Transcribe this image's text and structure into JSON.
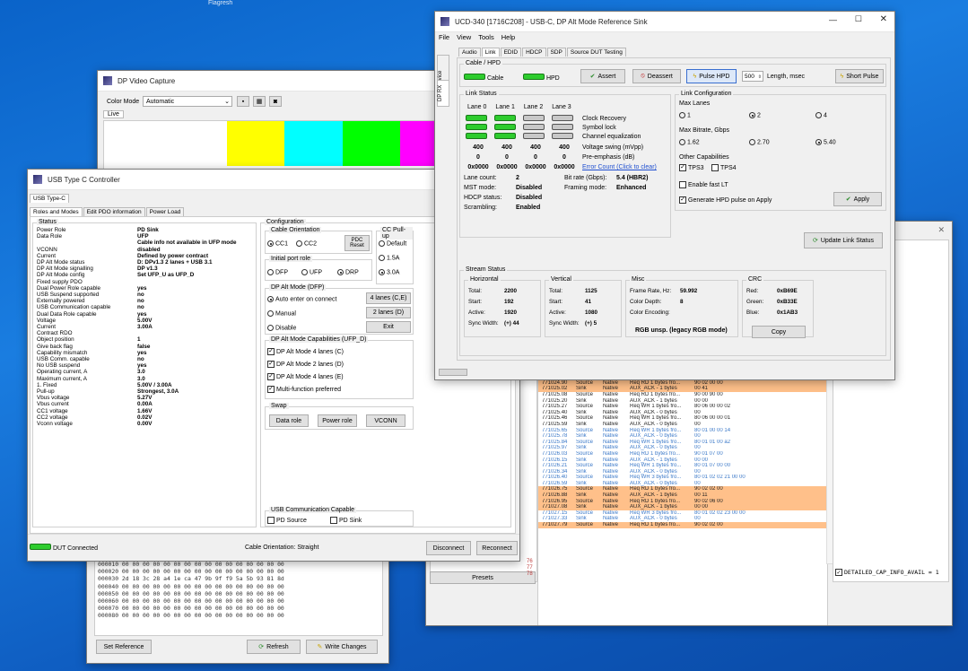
{
  "desktop": {
    "top_label": "Flagresh"
  },
  "capture": {
    "title": "DP Video Capture",
    "color_mode_label": "Color Mode",
    "color_mode_value": "Automatic",
    "tab": "Live",
    "bars": [
      "#ffffff",
      "#ffff00",
      "#00ffff",
      "#00ff00",
      "#ff00ff",
      "#ff0000",
      "#0000ff"
    ]
  },
  "ucd": {
    "title": "UCD-340 [1716C208] - USB-C, DP Alt Mode Reference Sink",
    "menu": [
      "File",
      "View",
      "Tools",
      "Help"
    ],
    "side_tabs": [
      "Device",
      "DP RX"
    ],
    "tabs": [
      "Audio",
      "Link",
      "EDID",
      "HDCP",
      "SDP",
      "Source DUT Testing"
    ],
    "cable_hpd": {
      "group": "Cable / HPD",
      "cable": "Cable",
      "hpd": "HPD",
      "assert": "Assert",
      "deassert": "Deassert",
      "pulse": "Pulse HPD",
      "pulse_len": "500",
      "len_label": "Length, msec",
      "short_pulse": "Short Pulse"
    },
    "link_status": {
      "group": "Link Status",
      "lanes": [
        "Lane 0",
        "Lane 1",
        "Lane 2",
        "Lane 3"
      ],
      "rows": [
        "Clock Recovery",
        "Symbol lock",
        "Channel equalization"
      ],
      "swing": [
        "400",
        "400",
        "400",
        "400"
      ],
      "swing_label": "Voltage swing (mVpp)",
      "pre": [
        "0",
        "0",
        "0",
        "0"
      ],
      "pre_label": "Pre-emphasis (dB)",
      "err": [
        "0x0000",
        "0x0000",
        "0x0000",
        "0x0000"
      ],
      "err_label": "Error Count (Click to clear)",
      "lane_count_l": "Lane count:",
      "lane_count": "2",
      "bitrate_l": "Bit rate (Gbps):",
      "bitrate": "5.4 (HBR2)",
      "mst_l": "MST mode:",
      "mst": "Disabled",
      "framing_l": "Framing mode:",
      "framing": "Enhanced",
      "hdcp_l": "HDCP status:",
      "hdcp": "Disabled",
      "scr_l": "Scrambling:",
      "scr": "Enabled"
    },
    "link_config": {
      "group": "Link Configuration",
      "max_lanes": "Max Lanes",
      "lanes": [
        "1",
        "2",
        "4"
      ],
      "bitrate_label": "Max Bitrate, Gbps",
      "rates": [
        "1.62",
        "2.70",
        "5.40"
      ],
      "other": "Other Capabilities",
      "tps3": "TPS3",
      "tps4": "TPS4",
      "fast_lt": "Enable fast LT",
      "gen_hpd": "Generate HPD pulse on Apply",
      "apply": "Apply",
      "update": "Update Link Status"
    },
    "stream": {
      "group": "Stream Status",
      "h_title": "Horizontal",
      "v_title": "Vertical",
      "misc_title": "Misc",
      "crc_title": "CRC",
      "h": [
        [
          "Total:",
          "2200"
        ],
        [
          "Start:",
          "192"
        ],
        [
          "Active:",
          "1920"
        ],
        [
          "Sync Width:",
          "(+) 44"
        ]
      ],
      "v": [
        [
          "Total:",
          "1125"
        ],
        [
          "Start:",
          "41"
        ],
        [
          "Active:",
          "1080"
        ],
        [
          "Sync Width:",
          "(+) 5"
        ]
      ],
      "misc": [
        [
          "Frame Rate, Hz:",
          "59.992"
        ],
        [
          "Color Depth:",
          "8"
        ],
        [
          "Color Encoding:",
          ""
        ]
      ],
      "encoding": "RGB unsp. (legacy RGB mode)",
      "crc": [
        [
          "Red:",
          "0xB69E"
        ],
        [
          "Green:",
          "0xB33E"
        ],
        [
          "Blue:",
          "0x1AB3"
        ]
      ],
      "copy": "Copy"
    }
  },
  "usbc": {
    "title": "USB Type C Controller",
    "tab": "USB Type-C",
    "subtabs": [
      "Roles and Modes",
      "Edit PDO information",
      "Power Load"
    ],
    "status_group": "Status",
    "status": [
      [
        "Power Role",
        "PD Sink"
      ],
      [
        "Data Role",
        "UFP"
      ],
      [
        "",
        "Cable info not available in UFP mode"
      ],
      [
        "VCONN",
        "disabled"
      ],
      [
        "Current",
        "Defined by power contract"
      ],
      [
        "DP Alt Mode status",
        "D: DPv1.3 2 lanes + USB 3.1"
      ],
      [
        "DP Alt Mode signalling",
        "DP v1.3"
      ],
      [
        "DP Alt Mode config",
        "Set UFP_U as UFP_D"
      ],
      [
        "",
        ""
      ],
      [
        "Fixed supply PDO",
        ""
      ],
      [
        "Dual Power Role capable",
        "yes"
      ],
      [
        "USB Suspend supported",
        "no"
      ],
      [
        "Externally powered",
        "no"
      ],
      [
        "USB Communication capable",
        "no"
      ],
      [
        "Dual Data Role capable",
        "yes"
      ],
      [
        "Voltage",
        "5.00V"
      ],
      [
        "Current",
        "3.00A"
      ],
      [
        "",
        ""
      ],
      [
        "Contract RDO",
        ""
      ],
      [
        "Object position",
        "1"
      ],
      [
        "Give back flag",
        "false"
      ],
      [
        "Capability mismatch",
        "yes"
      ],
      [
        "USB Comm. capable",
        "no"
      ],
      [
        "No USB suspend",
        "yes"
      ],
      [
        "Operating current, A",
        "3.0"
      ],
      [
        "Maximum current, A",
        "3.0"
      ],
      [
        "",
        ""
      ],
      [
        "  1. Fixed",
        "5.00V / 3.00A"
      ],
      [
        "",
        ""
      ],
      [
        "Pull-up",
        "Strongest, 3.0A"
      ],
      [
        "Vbus voltage",
        "5.27V"
      ],
      [
        "Vbus current",
        "0.00A"
      ],
      [
        "CC1 voltage",
        "1.66V"
      ],
      [
        "CC2 voltage",
        "0.02V"
      ],
      [
        "Vconn voltage",
        "0.00V"
      ]
    ],
    "config": {
      "group": "Configuration",
      "orient": "Cable Orientation",
      "cc1": "CC1",
      "cc2": "CC2",
      "pdc": "PDC Reset",
      "ccpull": "CC Pull-up",
      "pull": [
        "Default",
        "1.5A",
        "3.0A"
      ],
      "port_role": "Initial port role",
      "roles": [
        "DFP",
        "UFP",
        "DRP"
      ],
      "altmode": "DP Alt Mode (DFP)",
      "auto": "Auto enter on connect",
      "manual": "Manual",
      "disable": "Disable",
      "lanes_ce": "4 lanes (C,E)",
      "lanes_d": "2 lanes (D)",
      "exit": "Exit",
      "caps": "DP Alt Mode Capabilities (UFP_D)",
      "cap_items": [
        "DP Alt Mode 4 lanes (C)",
        "DP Alt Mode 2 lanes (D)",
        "DP Alt Mode 4 lanes (E)",
        "Multi-function preferred"
      ],
      "swap": "Swap",
      "swap_btns": [
        "Data role",
        "Power role",
        "VCONN"
      ],
      "usbcomm": "USB Communication Capable",
      "pd_source": "PD Source",
      "pd_sink": "PD Sink"
    },
    "footer": {
      "connected": "DUT Connected",
      "orient": "Cable Orientation: Straight",
      "disconnect": "Disconnect",
      "reconnect": "Reconnect"
    }
  },
  "hex": {
    "rows": [
      "000010 00 00 00 00 00 00 00 00 00 00 00 00 00 00 00 00",
      "000020 00 00 00 00 00 00 00 00 00 00 00 00 00 00 00 00",
      "000030 2d 18 3c 28 a4 1e ca 47 9b 9f f9 5a 5b 93 81 8d",
      "000040 00 00 00 00 00 00 00 00 00 00 00 00 00 00 00 00",
      "000050 00 00 00 00 00 00 00 00 00 00 00 00 00 00 00 00",
      "000060 00 00 00 00 00 00 00 00 00 00 00 00 00 00 00 00",
      "000070 00 00 00 00 00 00 00 00 00 00 00 00 00 00 00 00",
      "000080 00 00 00 00 00 00 00 00 00 00 00 00 00 00 00 00"
    ],
    "set_ref": "Set Reference",
    "refresh": "Refresh",
    "write": "Write Changes"
  },
  "aux": {
    "presets": "Presets",
    "row_nums": [
      "76",
      "77",
      "78"
    ],
    "detail": "DETAILED_CAP_INFO_AVAIL = 1",
    "log": [
      [
        "771024.52",
        "Sink",
        "Native",
        "AUX_ACK - 1 bytes",
        "00 80",
        "w"
      ],
      [
        "771024.58",
        "Source",
        "Native",
        "Req RD 16 bytes fr...",
        "90 22 00 0F",
        "w"
      ],
      [
        "771024.71",
        "Sink",
        "Native",
        "AUX_ACK - 16 bytes",
        "00 14 14 e2 01 01 00 01...",
        "w"
      ],
      [
        "771024.90",
        "Source",
        "Native",
        "Req RD 1 bytes fro...",
        "90 02 00 00",
        "o"
      ],
      [
        "771025.02",
        "Sink",
        "Native",
        "AUX_ACK - 1 bytes",
        "00 41",
        "o"
      ],
      [
        "771025.08",
        "Source",
        "Native",
        "Req RD 1 bytes fro...",
        "90 00 90 00",
        "w"
      ],
      [
        "771025.20",
        "Sink",
        "Native",
        "AUX_ACK - 1 bytes",
        "00 00",
        "w"
      ],
      [
        "771025.27",
        "Source",
        "Native",
        "Req WR 1 bytes fro...",
        "80 06 00 00 02",
        "w"
      ],
      [
        "771025.40",
        "Sink",
        "Native",
        "AUX_ACK - 0 bytes",
        "00",
        "w"
      ],
      [
        "771025.46",
        "Source",
        "Native",
        "Req WR 1 bytes fro...",
        "80 06 00 00 01",
        "w"
      ],
      [
        "771025.59",
        "Sink",
        "Native",
        "AUX_ACK - 0 bytes",
        "00",
        "w"
      ],
      [
        "771025.65",
        "Source",
        "Native",
        "Req WR 1 bytes fro...",
        "80 01 00 00 14",
        "b"
      ],
      [
        "771025.78",
        "Sink",
        "Native",
        "AUX_ACK - 0 bytes",
        "00",
        "b"
      ],
      [
        "771025.84",
        "Source",
        "Native",
        "Req WR 1 bytes fro...",
        "80 01 01 00 a2",
        "b"
      ],
      [
        "771025.97",
        "Sink",
        "Native",
        "AUX_ACK - 0 bytes",
        "00",
        "b"
      ],
      [
        "771026.03",
        "Source",
        "Native",
        "Req RD 1 bytes fro...",
        "90 01 07 00",
        "b"
      ],
      [
        "771026.15",
        "Sink",
        "Native",
        "AUX_ACK - 1 bytes",
        "00 00",
        "b"
      ],
      [
        "771026.21",
        "Source",
        "Native",
        "Req WR 1 bytes fro...",
        "80 01 07 00 00",
        "b"
      ],
      [
        "771026.34",
        "Sink",
        "Native",
        "AUX_ACK - 0 bytes",
        "00",
        "b"
      ],
      [
        "771026.40",
        "Source",
        "Native",
        "Req WR 3 bytes fro...",
        "80 01 02 02 21 00 00",
        "b"
      ],
      [
        "771026.59",
        "Sink",
        "Native",
        "AUX_ACK - 0 bytes",
        "00",
        "b"
      ],
      [
        "771026.75",
        "Source",
        "Native",
        "Req RD 1 bytes fro...",
        "90 02 02 00",
        "o"
      ],
      [
        "771026.88",
        "Sink",
        "Native",
        "AUX_ACK - 1 bytes",
        "00 11",
        "o"
      ],
      [
        "771026.95",
        "Source",
        "Native",
        "Req RD 1 bytes fro...",
        "90 02 06 00",
        "o"
      ],
      [
        "771027.08",
        "Sink",
        "Native",
        "AUX_ACK - 1 bytes",
        "00 00",
        "o"
      ],
      [
        "771027.15",
        "Source",
        "Native",
        "Req WR 3 bytes fro...",
        "80 01 02 02 23 00 00",
        "b"
      ],
      [
        "771027.33",
        "Sink",
        "Native",
        "AUX_ACK - 0 bytes",
        "00",
        "b"
      ],
      [
        "771027.79",
        "Source",
        "Native",
        "Req RD 1 bytes fro...",
        "90 02 02 00",
        "o"
      ]
    ]
  }
}
